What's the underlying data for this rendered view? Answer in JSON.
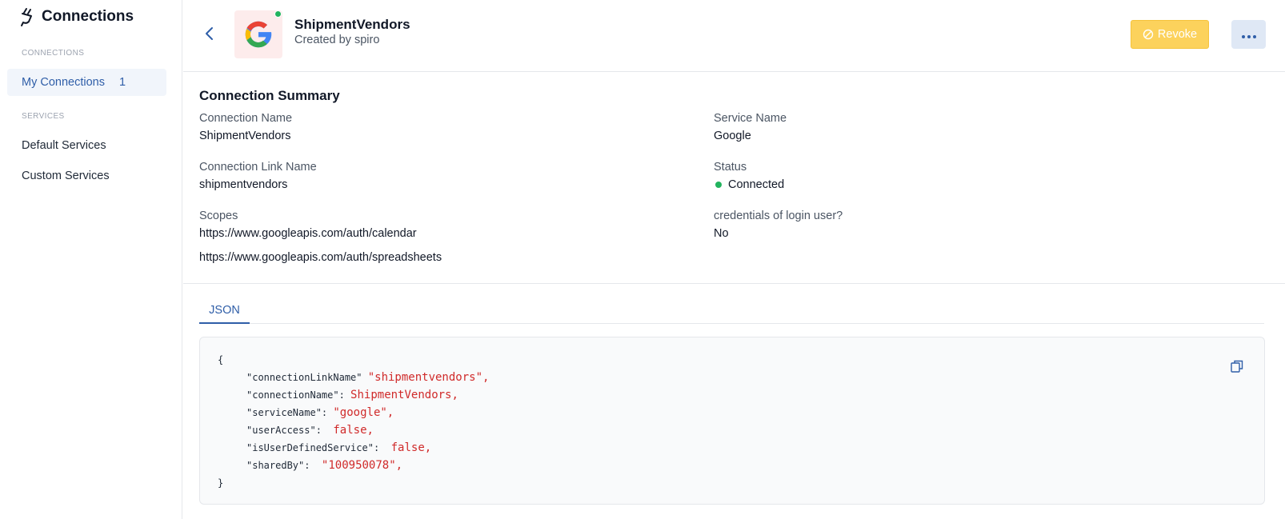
{
  "sidebar": {
    "title": "Connections",
    "sections": [
      {
        "label": "CONNECTIONS",
        "items": [
          {
            "label": "My Connections",
            "count": "1",
            "active": true
          }
        ]
      },
      {
        "label": "SERVICES",
        "items": [
          {
            "label": "Default Services"
          },
          {
            "label": "Custom Services"
          }
        ]
      }
    ]
  },
  "header": {
    "title": "ShipmentVendors",
    "subtitle": "Created by spiro",
    "revoke_label": "Revoke",
    "status_color": "#22b35e"
  },
  "summary": {
    "title": "Connection Summary",
    "connection_name_label": "Connection Name",
    "connection_name": "ShipmentVendors",
    "service_name_label": "Service Name",
    "service_name": "Google",
    "link_name_label": "Connection Link Name",
    "link_name": "shipmentvendors",
    "status_label": "Status",
    "status": "Connected",
    "scopes_label": "Scopes",
    "scopes": [
      "https://www.googleapis.com/auth/calendar",
      "https://www.googleapis.com/auth/spreadsheets"
    ],
    "credentials_label": "credentials of login user?",
    "credentials": "No"
  },
  "tabs": {
    "json_label": "JSON"
  },
  "json": {
    "open": "{",
    "close": "}",
    "rows": [
      {
        "key": "\"connectionLinkName\" ",
        "value": "\"shipmentvendors\","
      },
      {
        "key": "\"connectionName\": ",
        "value": "ShipmentVendors,"
      },
      {
        "key": "\"serviceName\": ",
        "value": "\"google\","
      },
      {
        "key": "\"userAccess\":  ",
        "value": "false,"
      },
      {
        "key": "\"isUserDefinedService\":  ",
        "value": "false,"
      },
      {
        "key": "\"sharedBy\":  ",
        "value": "\"100950078\","
      }
    ]
  },
  "colors": {
    "accent": "#2f5ea8",
    "revoke": "#fcd25c",
    "json_string": "#d02a2a",
    "success": "#22b35e"
  }
}
